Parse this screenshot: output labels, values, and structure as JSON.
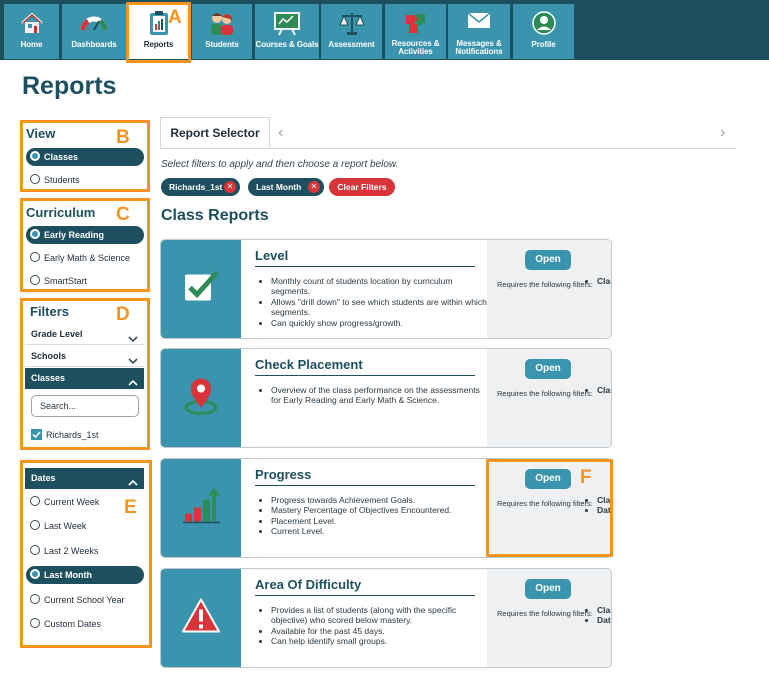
{
  "nav": {
    "items": [
      {
        "label": "Home",
        "icon": "home-icon"
      },
      {
        "label": "Dashboards",
        "icon": "gauge-icon"
      },
      {
        "label": "Reports",
        "icon": "clipboard-chart-icon",
        "active": true
      },
      {
        "label": "Students",
        "icon": "students-icon"
      },
      {
        "label": "Courses & Goals",
        "icon": "chalkboard-icon"
      },
      {
        "label": "Assessment",
        "icon": "scales-icon"
      },
      {
        "label": "Resources & Activities",
        "icon": "puzzle-icon"
      },
      {
        "label": "Messages & Notifications",
        "icon": "envelope-icon"
      },
      {
        "label": "Profile",
        "icon": "profile-icon"
      }
    ]
  },
  "page": {
    "title": "Reports"
  },
  "callouts": {
    "a": "A",
    "b": "B",
    "c": "C",
    "d": "D",
    "e": "E",
    "f": "F"
  },
  "view": {
    "title": "View",
    "options": [
      "Classes",
      "Students"
    ],
    "selected": "Classes"
  },
  "curriculum": {
    "title": "Curriculum",
    "options": [
      "Early Reading",
      "Early Math & Science",
      "SmartStart"
    ],
    "selected": "Early Reading"
  },
  "filters": {
    "title": "Filters",
    "grade_level": "Grade Level",
    "schools": "Schools",
    "classes": "Classes",
    "search_placeholder": "Search...",
    "class_item": "Richards_1st"
  },
  "dates": {
    "title": "Dates",
    "options": [
      "Current Week",
      "Last Week",
      "Last 2 Weeks",
      "Last Month",
      "Current School Year",
      "Custom Dates"
    ],
    "selected": "Last Month"
  },
  "main": {
    "tab": "Report Selector",
    "instruction": "Select filters to apply and then choose a report below.",
    "chips": [
      "Richards_1st",
      "Last Month"
    ],
    "clear_filters": "Clear Filters",
    "section_title": "Class Reports",
    "open_label": "Open",
    "requires_label": "Requires the following filters:"
  },
  "reports": [
    {
      "title": "Level",
      "icon": "checkbox-icon",
      "bullets": [
        "Monthly count of students location by curriculum segments.",
        "Allows \"drill down\" to see which students are within which segments.",
        "Can quickly show progress/growth."
      ],
      "filters": [
        "Classes"
      ]
    },
    {
      "title": "Check Placement",
      "icon": "map-pin-icon",
      "bullets": [
        "Overview of the class performance on the assessments for Early Reading and Early Math & Science."
      ],
      "filters": [
        "Classes"
      ]
    },
    {
      "title": "Progress",
      "icon": "bar-growth-icon",
      "bullets": [
        "Progress towards Achievement Goals.",
        "Mastery Percentage of Objectives Encountered.",
        "Placement Level.",
        "Current Level."
      ],
      "filters": [
        "Classes",
        "Dates"
      ]
    },
    {
      "title": "Area Of Difficulty",
      "icon": "warning-icon",
      "bullets": [
        "Provides a list of students (along with the specific objective) who scored below mastery.",
        "Available for the past 45 days.",
        "Can help identify small groups."
      ],
      "filters": [
        "Classes",
        "Dates"
      ]
    }
  ],
  "colors": {
    "navy": "#1e4f5e",
    "teal": "#3a94ad",
    "callout": "#f7941d",
    "danger": "#d9343a"
  }
}
